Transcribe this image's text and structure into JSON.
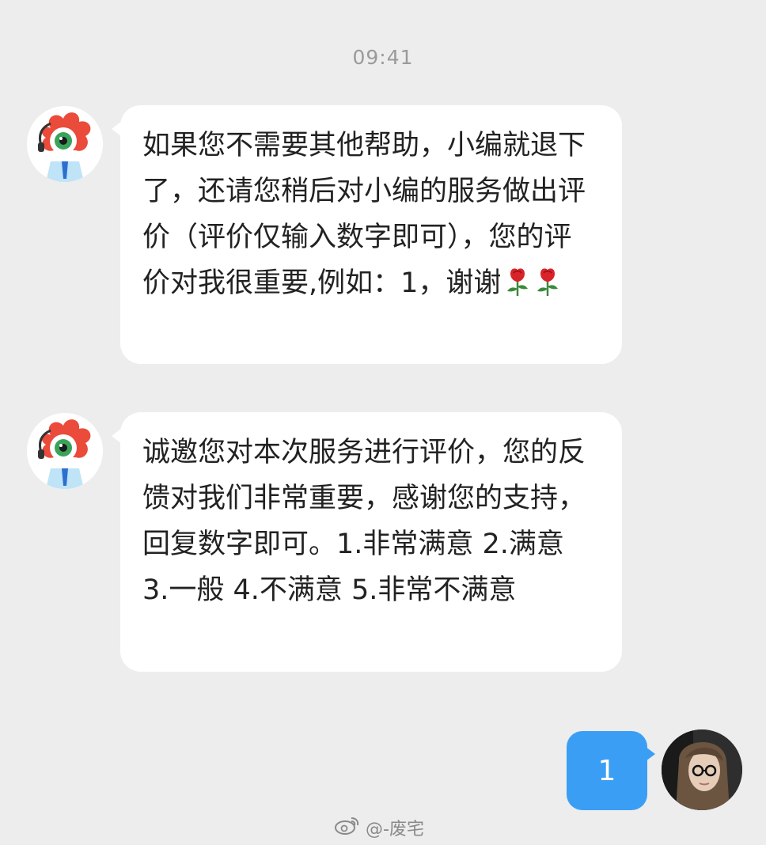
{
  "chat": {
    "timestamp": "09:41",
    "messages": [
      {
        "sender": "bot",
        "text": "如果您不需要其他帮助，小编就退下了，还请您稍后对小编的服务做出评价（评价仅输入数字即可），您的评价对我很重要,例如：1，谢谢",
        "trailing_emoji": [
          "rose-icon",
          "rose-icon"
        ]
      },
      {
        "sender": "bot",
        "text": "诚邀您对本次服务进行评价，您的反馈对我们非常重要，感谢您的支持，回复数字即可。1.非常满意 2.满意 3.一般 4.不满意 5.非常不满意"
      },
      {
        "sender": "user",
        "text": "1"
      }
    ]
  },
  "watermark": {
    "handle": "@-废宅"
  },
  "colors": {
    "background": "#ededed",
    "bubble_incoming": "#ffffff",
    "bubble_outgoing": "#3b9ef5",
    "timestamp_text": "#9a9a9a",
    "mascot_red": "#ea4b3a"
  }
}
